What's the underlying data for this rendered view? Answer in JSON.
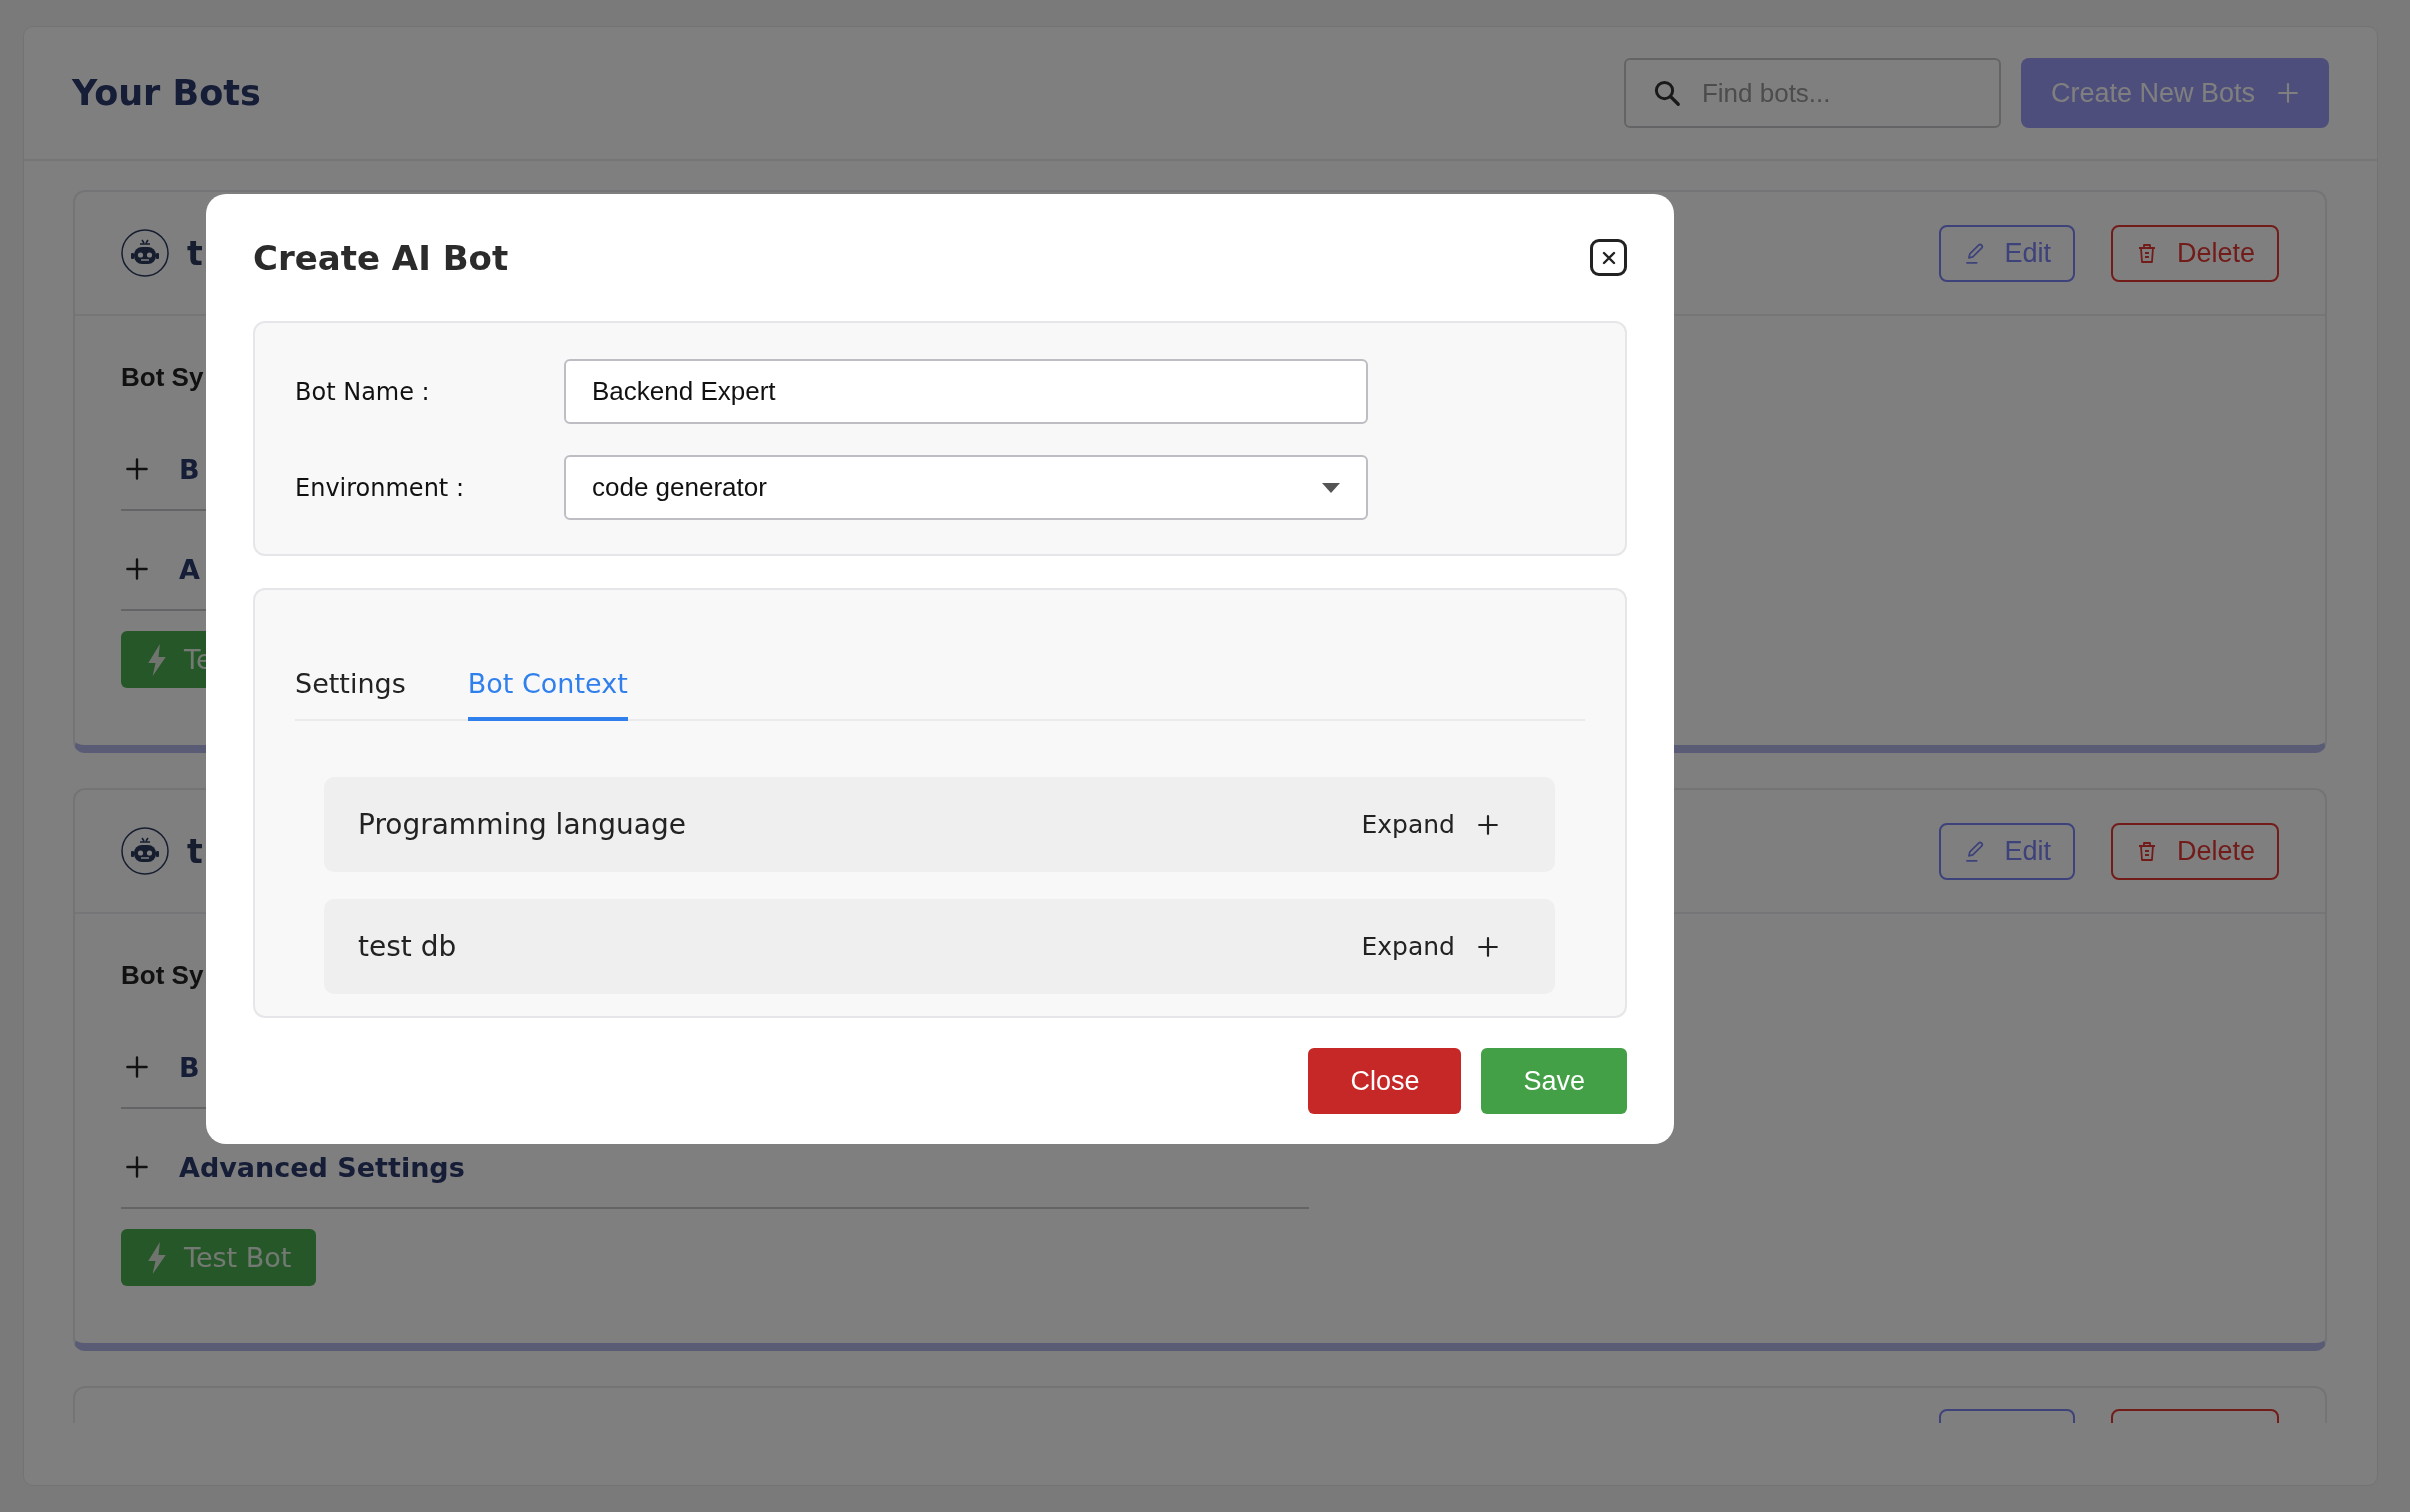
{
  "page": {
    "title": "Your Bots",
    "search": {
      "placeholder": "Find bots..."
    },
    "create_button": "Create New Bots"
  },
  "bots": [
    {
      "name": "t",
      "section_title": "Bot Sy",
      "settings": [
        "B",
        "A"
      ],
      "test_button": "Te",
      "edit_button": "Edit",
      "delete_button": "Delete"
    },
    {
      "name": "t",
      "section_title": "Bot Sy",
      "settings": [
        "B",
        "Advanced Settings"
      ],
      "test_button": "Test Bot",
      "edit_button": "Edit",
      "delete_button": "Delete"
    }
  ],
  "modal": {
    "title": "Create AI Bot",
    "fields": [
      {
        "label": "Bot Name :",
        "kind": "text",
        "value": "Backend Expert"
      },
      {
        "label": "Environment :",
        "kind": "select",
        "value": "code generator"
      }
    ],
    "tabs": [
      {
        "label": "Settings",
        "selected": false
      },
      {
        "label": "Bot Context",
        "selected": true
      }
    ],
    "context_items": [
      {
        "title": "Programming language",
        "action": "Expand"
      },
      {
        "title": "test db",
        "action": "Expand"
      }
    ],
    "buttons": [
      {
        "label": "Close",
        "kind": "danger"
      },
      {
        "label": "Save",
        "kind": "primary"
      }
    ]
  }
}
